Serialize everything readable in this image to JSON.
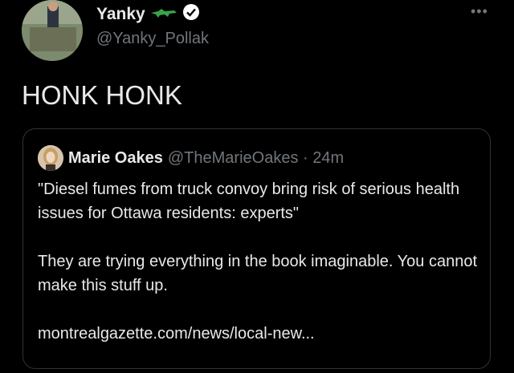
{
  "author": {
    "name": "Yanky",
    "handle": "@Yanky_Pollak"
  },
  "menu": {
    "more_label": "•••"
  },
  "tweet": {
    "text": "HONK HONK"
  },
  "quoted": {
    "name": "Marie Oakes",
    "handle_time": "@TheMarieOakes · 24m",
    "headline": "\"Diesel fumes from truck convoy bring risk of serious health issues for Ottawa residents: experts\"",
    "comment": "They are trying everything in the book imaginable. You cannot make this stuff up.",
    "link": "montrealgazette.com/news/local-new..."
  },
  "colors": {
    "background": "#000000",
    "text": "#e7e9ea",
    "secondary": "#71767b",
    "border": "#2f3336",
    "verified": "#ffffff",
    "alligator": "#3aa34a"
  }
}
